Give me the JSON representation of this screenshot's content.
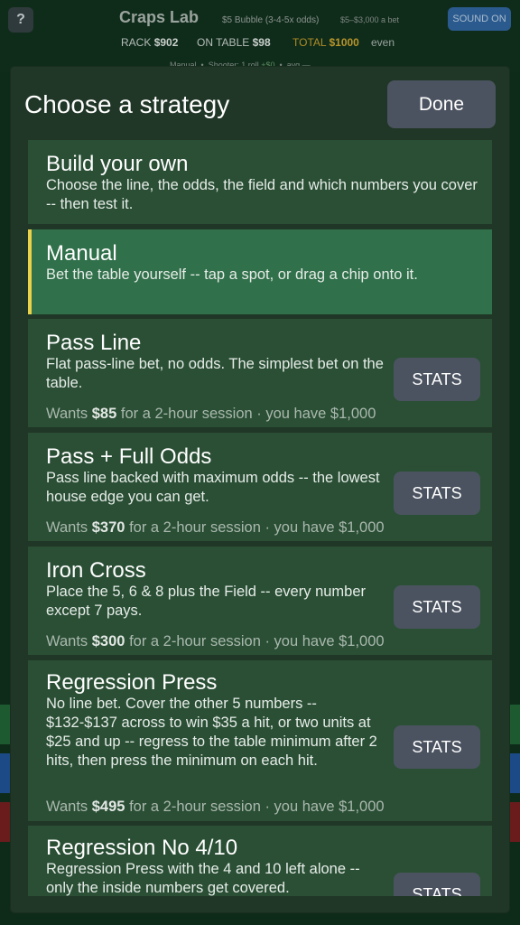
{
  "header": {
    "help_label": "?",
    "app_title": "Craps Lab",
    "table_name": "$5 Bubble (3-4-5x odds)",
    "table_limits": "$5–$3,000 a bet",
    "sound_label": "SOUND  ON",
    "rack_label": "RACK",
    "rack_value": "$902",
    "on_table_label": "ON TABLE",
    "on_table_value": "$98",
    "total_label": "TOTAL",
    "total_value": "$1000",
    "even_label": "even",
    "mode": "Manual",
    "shooter": "Shooter: 1 roll",
    "shooter_delta": "+$0",
    "avg": "avg —"
  },
  "modal": {
    "title": "Choose a strategy",
    "done_label": "Done",
    "strategies": [
      {
        "name": "Build your own",
        "desc": "Choose the line, the odds, the field and which numbers you cover -- then test it."
      },
      {
        "name": "Manual",
        "desc": "Bet the table yourself -- tap a spot, or drag a chip onto it.",
        "selected": true
      },
      {
        "name": "Pass Line",
        "desc": "Flat pass-line bet, no odds. The simplest bet on the table.",
        "wants_prefix": "Wants",
        "wants_amount": "$85",
        "wants_suffix": "for a 2-hour session · you have $1,000",
        "stats_label": "STATS"
      },
      {
        "name": "Pass + Full Odds",
        "desc": "Pass line backed with maximum odds -- the lowest house edge you can get.",
        "wants_prefix": "Wants",
        "wants_amount": "$370",
        "wants_suffix": "for a 2-hour session · you have $1,000",
        "stats_label": "STATS"
      },
      {
        "name": "Iron Cross",
        "desc": "Place the 5, 6 & 8 plus the Field -- every number except 7 pays.",
        "wants_prefix": "Wants",
        "wants_amount": "$300",
        "wants_suffix": "for a 2-hour session · you have $1,000",
        "stats_label": "STATS"
      },
      {
        "name": "Regression Press",
        "desc": "No line bet. Cover the other 5 numbers -- $132-$137 across to win $35 a hit, or two units at $25 and up -- regress to the table minimum after 2 hits, then press the minimum on each hit.",
        "wants_prefix": "Wants",
        "wants_amount": "$495",
        "wants_suffix": "for a 2-hour session · you have $1,000",
        "stats_label": "STATS"
      },
      {
        "name": "Regression No 4/10",
        "desc": "Regression Press with the 4 and 10 left alone -- only the inside numbers get covered.",
        "stats_label": "STATS"
      }
    ]
  },
  "colors": {
    "background": "#0e2b1a",
    "modal": "#203626",
    "card": "#2a4f35",
    "card_selected": "#30704a",
    "selected_accent": "#ead34b",
    "button": "#4b5360",
    "total_gold": "#b08d25"
  }
}
